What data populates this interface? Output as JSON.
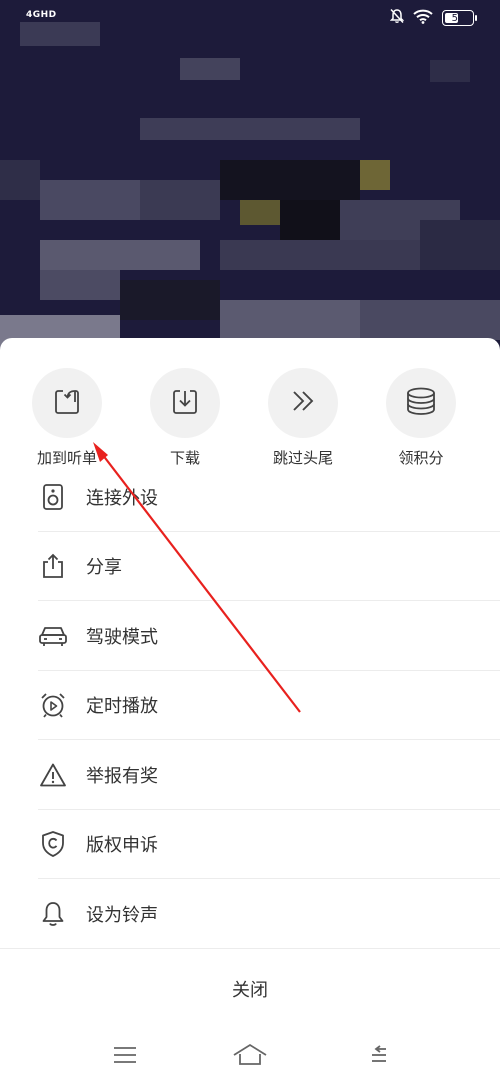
{
  "status_bar": {
    "network": "4GHD",
    "battery": "54",
    "battery_level": 0.54
  },
  "quick_actions": [
    {
      "label": "加到听单",
      "icon": "add-to-playlist-icon"
    },
    {
      "label": "下载",
      "icon": "download-icon"
    },
    {
      "label": "跳过头尾",
      "icon": "skip-intro-outro-icon"
    },
    {
      "label": "领积分",
      "icon": "points-coins-icon"
    }
  ],
  "menu_items": [
    {
      "label": "连接外设",
      "icon": "speaker-icon"
    },
    {
      "label": "分享",
      "icon": "share-icon"
    },
    {
      "label": "驾驶模式",
      "icon": "car-icon"
    },
    {
      "label": "定时播放",
      "icon": "alarm-clock-icon"
    },
    {
      "label": "举报有奖",
      "icon": "warning-icon"
    },
    {
      "label": "版权申诉",
      "icon": "copyright-shield-icon"
    },
    {
      "label": "设为铃声",
      "icon": "bell-icon"
    }
  ],
  "close_label": "关闭",
  "nav_bar": {
    "icons": [
      "menu-icon",
      "home-icon",
      "back-icon"
    ]
  },
  "colors": {
    "background_dark": "#1d1b3a",
    "sheet": "#ffffff",
    "text": "#333333",
    "icon_stroke": "#444444",
    "circle_bg": "#f1f1f1",
    "annotation": "#e8211e"
  }
}
